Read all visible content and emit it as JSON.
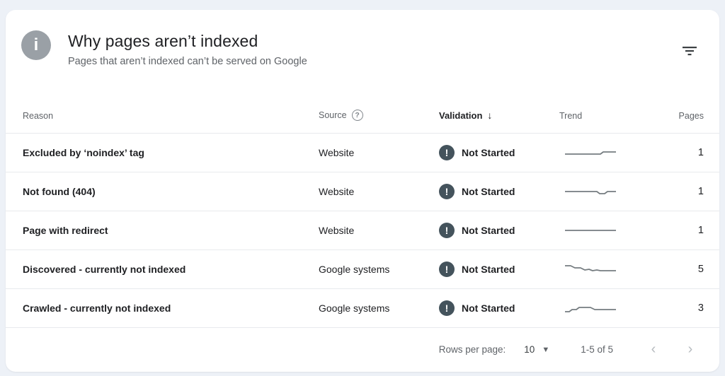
{
  "header": {
    "info_icon_glyph": "i",
    "title": "Why pages aren’t indexed",
    "subtitle": "Pages that aren’t indexed can’t be served on Google"
  },
  "columns": {
    "reason": "Reason",
    "source": "Source",
    "source_help_glyph": "?",
    "validation": "Validation",
    "validation_sort_icon": "↓",
    "trend": "Trend",
    "pages": "Pages"
  },
  "table": {
    "validation_icon_glyph": "!",
    "rows": [
      {
        "reason": "Excluded by ‘noindex’ tag",
        "source": "Website",
        "validation": "Not Started",
        "pages": "1",
        "trend_points": [
          [
            2,
            12
          ],
          [
            52,
            12
          ],
          [
            56,
            9
          ],
          [
            74,
            9
          ]
        ]
      },
      {
        "reason": "Not found (404)",
        "source": "Website",
        "validation": "Not Started",
        "pages": "1",
        "trend_points": [
          [
            2,
            10
          ],
          [
            47,
            10
          ],
          [
            51,
            13
          ],
          [
            58,
            13
          ],
          [
            62,
            10
          ],
          [
            74,
            10
          ]
        ]
      },
      {
        "reason": "Page with redirect",
        "source": "Website",
        "validation": "Not Started",
        "pages": "1",
        "trend_points": [
          [
            2,
            10
          ],
          [
            74,
            10
          ]
        ]
      },
      {
        "reason": "Discovered - currently not indexed",
        "source": "Google systems",
        "validation": "Not Started",
        "pages": "5",
        "trend_points": [
          [
            2,
            5
          ],
          [
            10,
            5
          ],
          [
            16,
            8
          ],
          [
            24,
            8
          ],
          [
            30,
            11
          ],
          [
            36,
            10
          ],
          [
            41,
            12
          ],
          [
            47,
            11
          ],
          [
            52,
            12
          ],
          [
            74,
            12
          ]
        ]
      },
      {
        "reason": "Crawled - currently not indexed",
        "source": "Google systems",
        "validation": "Not Started",
        "pages": "3",
        "trend_points": [
          [
            2,
            15
          ],
          [
            8,
            15
          ],
          [
            12,
            12
          ],
          [
            18,
            12
          ],
          [
            22,
            9
          ],
          [
            38,
            9
          ],
          [
            44,
            12
          ],
          [
            74,
            12
          ]
        ]
      }
    ]
  },
  "footer": {
    "rows_per_page_label": "Rows per page:",
    "rows_per_page_value": "10",
    "caret_glyph": "▼",
    "range": "1-5 of 5",
    "prev_glyph": "‹",
    "next_glyph": "›"
  },
  "colors": {
    "page_background": "#edf1f7",
    "card_background": "#ffffff",
    "text_primary": "#202124",
    "text_secondary": "#5f6368",
    "divider": "#e8eaed",
    "info_icon_background": "#9aa0a6",
    "not_started_badge": "#44535c",
    "sparkline": "#757c80"
  }
}
